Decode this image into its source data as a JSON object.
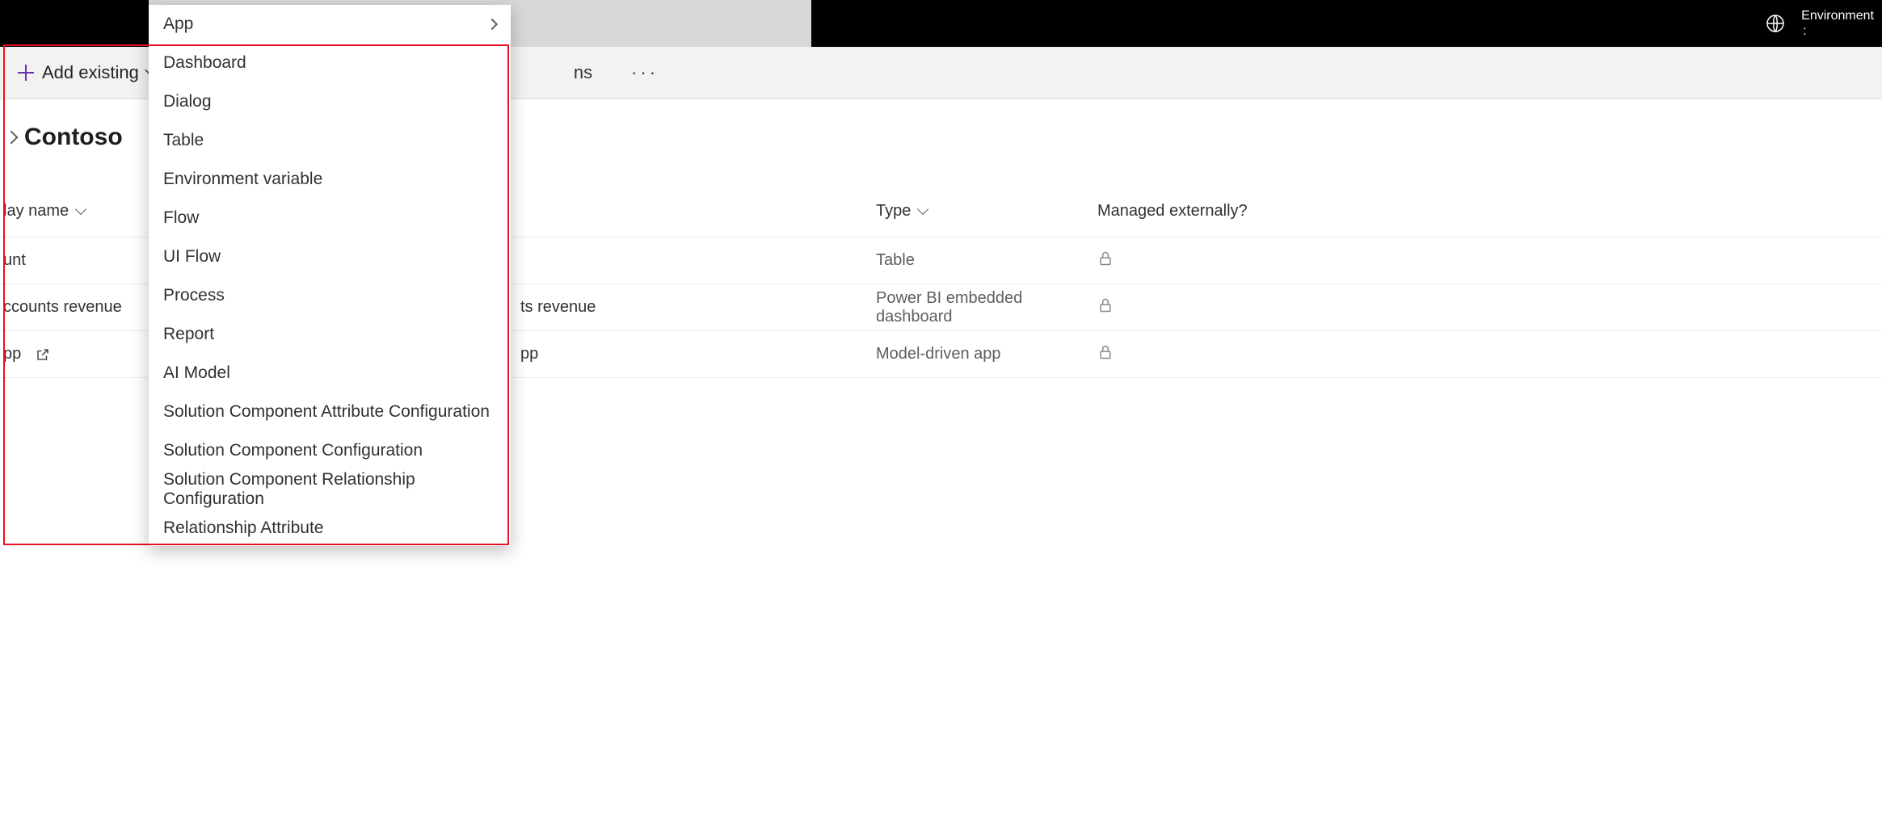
{
  "topbar": {
    "env_label": "Environment",
    "env_colon": ":"
  },
  "commandbar": {
    "add_existing": "Add existing",
    "partial_right": "ns",
    "ellipsis": "···"
  },
  "page": {
    "title": "Contoso"
  },
  "table": {
    "headers": {
      "display_name_partial": "lay name",
      "type": "Type",
      "managed_ext": "Managed externally?"
    },
    "rows": [
      {
        "name_partial": "unt",
        "mid_partial": "",
        "type": "Table",
        "locked": true,
        "has_open": false
      },
      {
        "name_partial": "ccounts revenue",
        "mid_partial": "ts revenue",
        "type": "Power BI embedded dashboard",
        "locked": true,
        "has_open": false
      },
      {
        "name_partial": "pp",
        "mid_partial": "pp",
        "type": "Model-driven app",
        "locked": true,
        "has_open": true
      }
    ]
  },
  "dropdown": {
    "items": [
      {
        "label": "App",
        "has_sub": true
      },
      {
        "label": "Dashboard",
        "has_sub": false
      },
      {
        "label": "Dialog",
        "has_sub": false
      },
      {
        "label": "Table",
        "has_sub": false
      },
      {
        "label": "Environment variable",
        "has_sub": false
      },
      {
        "label": "Flow",
        "has_sub": false
      },
      {
        "label": "UI Flow",
        "has_sub": false
      },
      {
        "label": "Process",
        "has_sub": false
      },
      {
        "label": "Report",
        "has_sub": false
      },
      {
        "label": "AI Model",
        "has_sub": false
      },
      {
        "label": "Solution Component Attribute Configuration",
        "has_sub": false
      },
      {
        "label": "Solution Component Configuration",
        "has_sub": false
      },
      {
        "label": "Solution Component Relationship Configuration",
        "has_sub": false
      },
      {
        "label": "Relationship Attribute",
        "has_sub": false
      }
    ]
  }
}
